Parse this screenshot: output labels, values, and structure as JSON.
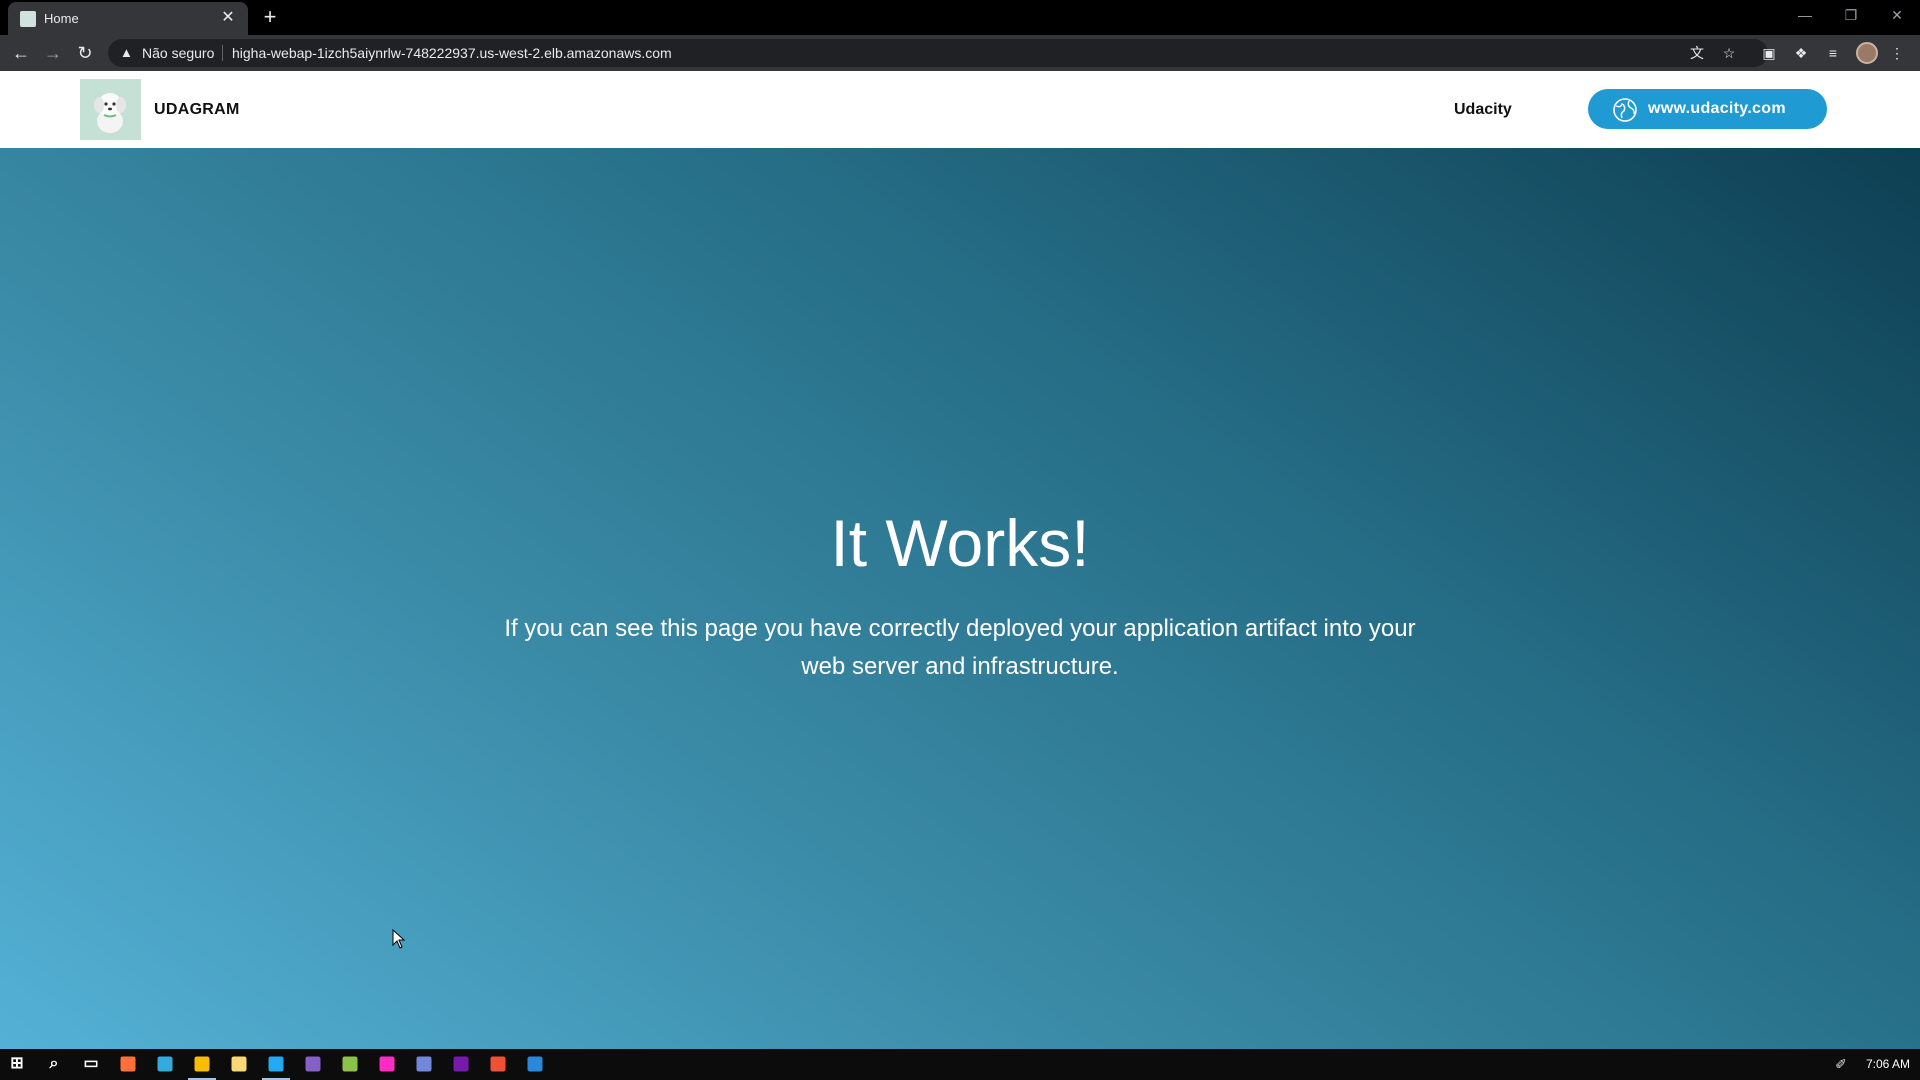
{
  "browser": {
    "tab_title": "Home",
    "tab_close": "✕",
    "new_tab": "+",
    "security_label": "Não seguro",
    "url": "higha-webap-1izch5aiynrlw-748222937.us-west-2.elb.amazonaws.com",
    "icons": [
      "back-icon",
      "forward-icon",
      "reload-icon",
      "warning-icon",
      "translate-icon",
      "bookmark-star-icon",
      "extension-icon",
      "puzzle-icon",
      "reading-list-icon",
      "profile-icon",
      "menu-icon"
    ]
  },
  "site": {
    "brand": "UDAGRAM",
    "nav_link": "Udacity",
    "cta_label": "www.udacity.com"
  },
  "hero": {
    "title": "It Works!",
    "text": "If you can see this page you have correctly deployed your application artifact into your web server and infrastructure."
  },
  "taskbar": {
    "clock": "7:06 AM",
    "apps": [
      {
        "name": "start-icon",
        "color": "#ffffff"
      },
      {
        "name": "search-icon",
        "color": "#ffffff"
      },
      {
        "name": "task-view-icon",
        "color": "#ffffff"
      },
      {
        "name": "firefox-icon",
        "color": "#ff7139"
      },
      {
        "name": "edge-icon",
        "color": "#33a9dc"
      },
      {
        "name": "chrome-icon",
        "color": "#fbbc04"
      },
      {
        "name": "file-explorer-icon",
        "color": "#f8d775"
      },
      {
        "name": "vscode-icon",
        "color": "#23a9f2"
      },
      {
        "name": "visual-studio-icon",
        "color": "#8661c5"
      },
      {
        "name": "lambda-icon",
        "color": "#8bc34a"
      },
      {
        "name": "adobe-xd-icon",
        "color": "#ff2bc2"
      },
      {
        "name": "discord-icon",
        "color": "#7289da"
      },
      {
        "name": "onenote-icon",
        "color": "#7719aa"
      },
      {
        "name": "git-icon",
        "color": "#f05033"
      },
      {
        "name": "document-icon",
        "color": "#2b88d8"
      }
    ]
  }
}
